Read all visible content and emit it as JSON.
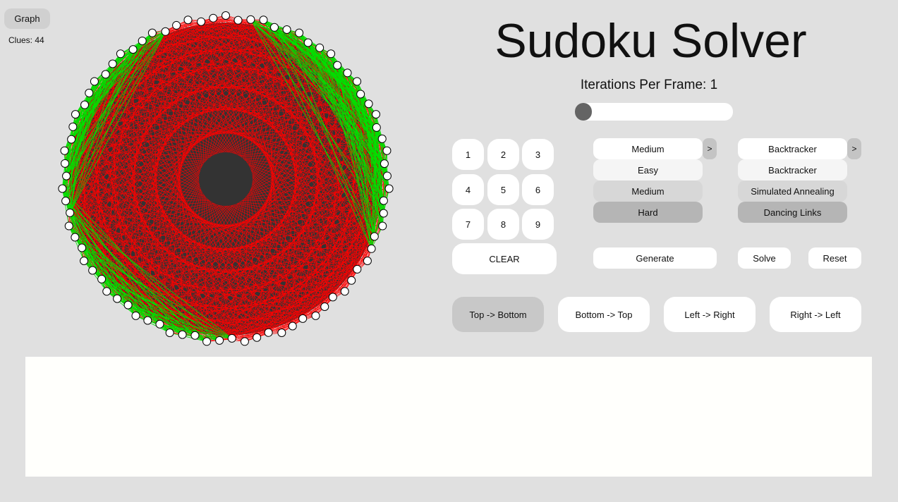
{
  "toolbar": {
    "graph_label": "Graph",
    "clues_text": "Clues: 44"
  },
  "header": {
    "title": "Sudoku Solver",
    "iterations_label": "Iterations Per Frame: 1"
  },
  "slider": {
    "value": 1
  },
  "numpad": {
    "keys": [
      "1",
      "2",
      "3",
      "4",
      "5",
      "6",
      "7",
      "8",
      "9"
    ],
    "clear_label": "CLEAR"
  },
  "difficulty": {
    "selected": "Medium",
    "arrow": ">",
    "options": [
      "Easy",
      "Medium",
      "Hard"
    ]
  },
  "algorithm": {
    "selected": "Backtracker",
    "arrow": ">",
    "options": [
      "Backtracker",
      "Simulated Annealing",
      "Dancing Links"
    ]
  },
  "actions": {
    "generate_label": "Generate",
    "solve_label": "Solve",
    "reset_label": "Reset"
  },
  "directions": [
    "Top -> Bottom",
    "Bottom -> Top",
    "Left -> Right",
    "Right -> Left"
  ],
  "graph": {
    "node_count": 81,
    "edge_color": "#ff0000",
    "highlight_color": "#00e000",
    "center_color": "#333333",
    "node_fill": "#ffffff"
  }
}
